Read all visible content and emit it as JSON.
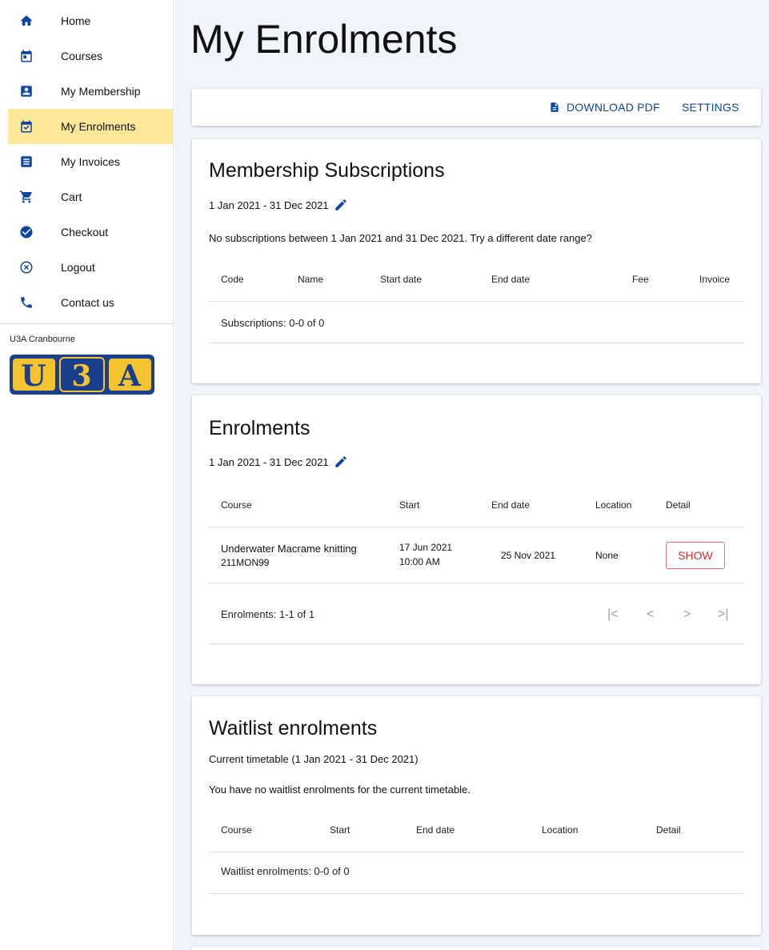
{
  "sidebar": {
    "items": [
      {
        "label": "Home",
        "icon": "home-icon"
      },
      {
        "label": "Courses",
        "icon": "calendar-icon"
      },
      {
        "label": "My Membership",
        "icon": "account-box-icon"
      },
      {
        "label": "My Enrolments",
        "icon": "calendar-check-icon"
      },
      {
        "label": "My Invoices",
        "icon": "list-icon"
      },
      {
        "label": "Cart",
        "icon": "cart-icon"
      },
      {
        "label": "Checkout",
        "icon": "check-circle-icon"
      },
      {
        "label": "Logout",
        "icon": "close-circle-icon"
      },
      {
        "label": "Contact us",
        "icon": "phone-icon"
      }
    ],
    "active_item": "My Enrolments",
    "org_name": "U3A Cranbourne",
    "logo_text": "U3A"
  },
  "page": {
    "title": "My Enrolments"
  },
  "toolbar": {
    "download_label": "DOWNLOAD PDF",
    "settings_label": "SETTINGS"
  },
  "membership": {
    "title": "Membership Subscriptions",
    "date_range": "1 Jan 2021 - 31 Dec 2021",
    "message": "No subscriptions between 1 Jan 2021 and 31 Dec 2021. Try a different date range?",
    "columns": [
      "Code",
      "Name",
      "Start date",
      "End date",
      "Fee",
      "Invoice"
    ],
    "footer": "Subscriptions: 0-0 of 0"
  },
  "enrolments": {
    "title": "Enrolments",
    "date_range": "1 Jan 2021 - 31 Dec 2021",
    "columns": [
      "Course",
      "Start",
      "End date",
      "Location",
      "Detail"
    ],
    "rows": [
      {
        "course_name": "Underwater Macrame knitting",
        "course_code": "211MON99",
        "start_date": "17 Jun 2021",
        "start_time": "10:00 AM",
        "end_date": "25 Nov 2021",
        "location": "None",
        "detail_label": "SHOW"
      }
    ],
    "footer": "Enrolments: 1-1 of 1",
    "pager": {
      "first": "|<",
      "prev": "<",
      "next": ">",
      "last": ">|"
    }
  },
  "waitlist": {
    "title": "Waitlist enrolments",
    "subtitle": "Current timetable (1 Jan 2021 - 31 Dec 2021)",
    "message": "You have no waitlist enrolments for the current timetable.",
    "columns": [
      "Course",
      "Start",
      "End date",
      "Location",
      "Detail"
    ],
    "footer": "Waitlist enrolments: 0-0 of 0"
  },
  "colors": {
    "accent": "#0d47a1",
    "active_nav": "#fde89a",
    "show_button": "#d32f2f",
    "background": "#f1f4fb"
  }
}
